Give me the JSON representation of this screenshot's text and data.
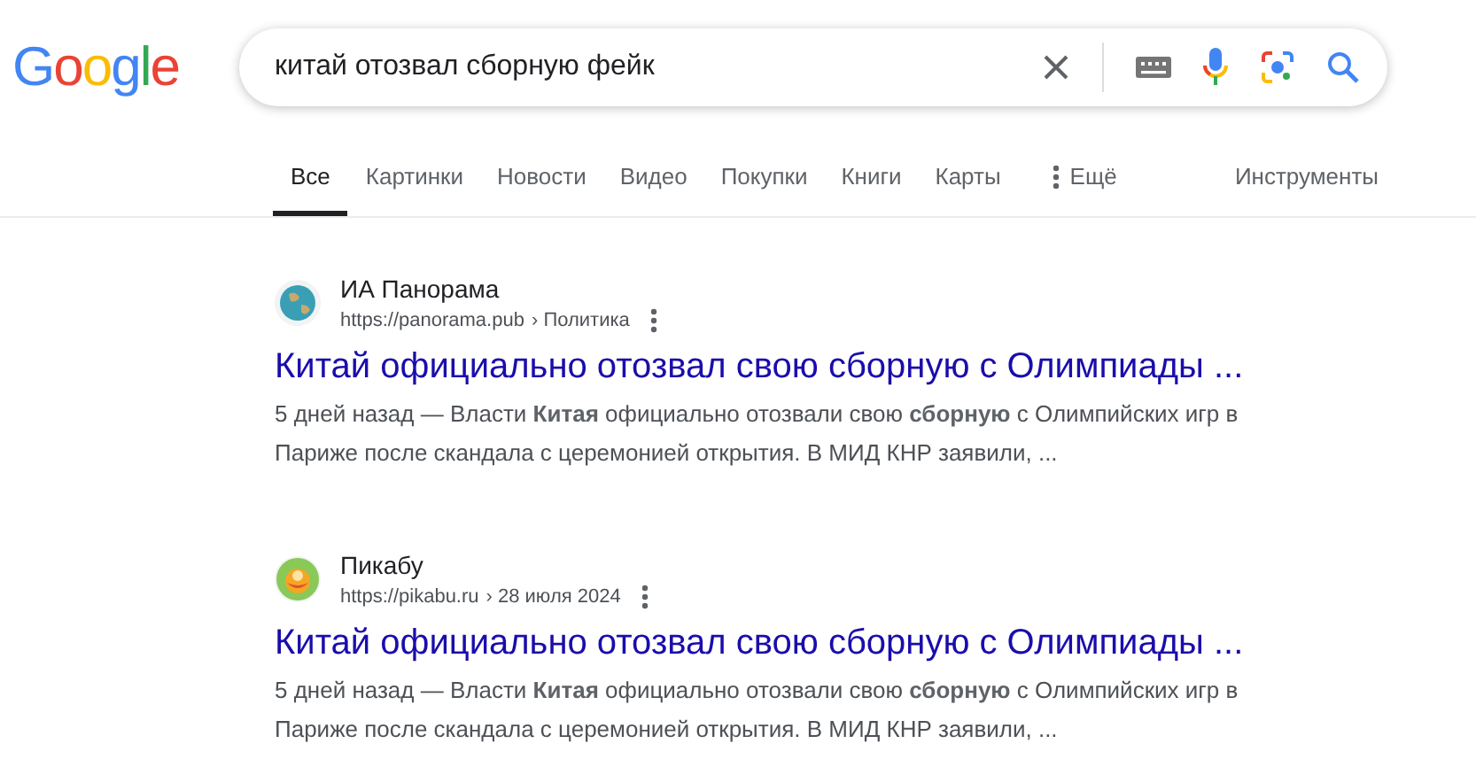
{
  "logo": "Google",
  "search": {
    "value": "китай отозвал сборную фейк"
  },
  "tabs": [
    {
      "label": "Все",
      "selected": true
    },
    {
      "label": "Картинки",
      "selected": false
    },
    {
      "label": "Новости",
      "selected": false
    },
    {
      "label": "Видео",
      "selected": false
    },
    {
      "label": "Покупки",
      "selected": false
    },
    {
      "label": "Книги",
      "selected": false
    },
    {
      "label": "Карты",
      "selected": false
    },
    {
      "label": "Ещё",
      "selected": false,
      "kind": "more"
    }
  ],
  "tools": "Инструменты",
  "results": [
    {
      "favicon": {
        "kind": "globe"
      },
      "site": "ИА Панорама",
      "url": "https://panorama.pub",
      "breadcrumb": "› Политика",
      "title": "Китай официально отозвал свою сборную с Олимпиады ...",
      "snippet": "5 дней назад — Власти **Китая** официально отозвали свою **сборную** с Олимпийских игр в Париже после скандала с церемонией открытия. В МИД КНР заявили, ..."
    },
    {
      "favicon": {
        "kind": "pikabu"
      },
      "site": "Пикабу",
      "url": "https://pikabu.ru",
      "breadcrumb": "› 28 июля 2024",
      "title": "Китай официально отозвал свою сборную с Олимпиады ...",
      "snippet": "5 дней назад — Власти **Китая** официально отозвали свою **сборную** с Олимпийских игр в Париже после скандала с церемонией открытия. В МИД КНР заявили, ..."
    }
  ]
}
